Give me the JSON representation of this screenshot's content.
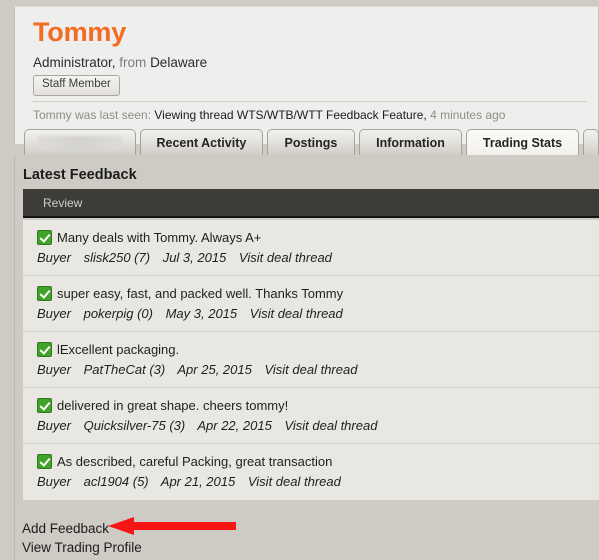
{
  "profile": {
    "username": "Tommy",
    "role": "Administrator,",
    "location_prefix": "from",
    "location": "Delaware",
    "staff_badge": "Staff Member",
    "last_seen_prefix": "Tommy was last seen:",
    "last_seen_activity": "Viewing thread WTS/WTB/WTT Feedback Feature,",
    "last_seen_time": "4 minutes ago",
    "accent_color": "#f26c21"
  },
  "tabs": [
    {
      "label": "",
      "redacted": true,
      "active": false
    },
    {
      "label": "Recent Activity",
      "redacted": false,
      "active": false
    },
    {
      "label": "Postings",
      "redacted": false,
      "active": false
    },
    {
      "label": "Information",
      "redacted": false,
      "active": false
    },
    {
      "label": "Trading Stats",
      "redacted": false,
      "active": true
    },
    {
      "label": "",
      "redacted": false,
      "active": false,
      "edge": true
    }
  ],
  "main": {
    "section_title": "Latest Feedback",
    "table_header": "Review",
    "header_bg": "#3e3c39",
    "check_color": "#3fa22a"
  },
  "feedback": [
    {
      "icon": "green-check-icon",
      "comment": "Many deals with Tommy. Always A+",
      "role": "Buyer",
      "user": "slisk250 (7)",
      "date": "Jul 3, 2015",
      "link": "Visit deal thread"
    },
    {
      "icon": "green-check-icon",
      "comment": "super easy, fast, and packed well. Thanks Tommy",
      "role": "Buyer",
      "user": "pokerpig (0)",
      "date": "May 3, 2015",
      "link": "Visit deal thread"
    },
    {
      "icon": "green-check-icon",
      "comment": "lExcellent packaging.",
      "role": "Buyer",
      "user": "PatTheCat (3)",
      "date": "Apr 25, 2015",
      "link": "Visit deal thread"
    },
    {
      "icon": "green-check-icon",
      "comment": "delivered in great shape. cheers tommy!",
      "role": "Buyer",
      "user": "Quicksilver-75 (3)",
      "date": "Apr 22, 2015",
      "link": "Visit deal thread"
    },
    {
      "icon": "green-check-icon",
      "comment": "As described, careful Packing, great transaction",
      "role": "Buyer",
      "user": "acl1904 (5)",
      "date": "Apr 21, 2015",
      "link": "Visit deal thread"
    }
  ],
  "bottom_links": [
    {
      "label": "Add Feedback"
    },
    {
      "label": "View Trading Profile"
    }
  ],
  "annotation": {
    "type": "arrow",
    "color": "#f71414",
    "points_to": "Add Feedback"
  }
}
